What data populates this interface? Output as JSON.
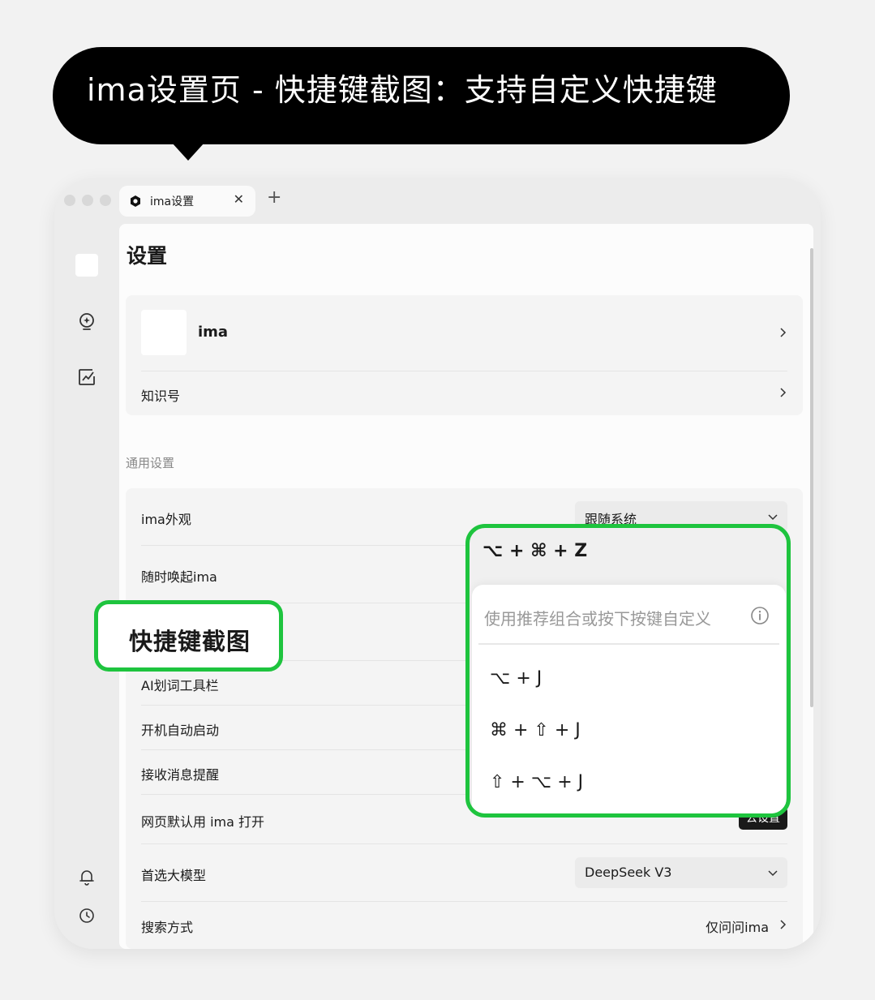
{
  "caption": "ima设置页 - 快捷键截图：支持自定义快捷键",
  "tab": {
    "title": "ima设置",
    "close": "✕",
    "add": "+"
  },
  "sidebar": {
    "icons": [
      "bulb-icon",
      "edit-icon",
      "bell-icon",
      "clock-icon"
    ]
  },
  "page": {
    "title": "设置"
  },
  "account": {
    "name": "ima",
    "knowledge_label": "知识号"
  },
  "section": {
    "general": "通用设置"
  },
  "settings": {
    "appearance_label": "ima外观",
    "appearance_value": "跟随系统",
    "wake_label": "随时唤起ima",
    "ai_toolbar_label": "AI划词工具栏",
    "autostart_label": "开机自动启动",
    "notify_label": "接收消息提醒",
    "webpage_label": "网页默认用 ima 打开",
    "webpage_button": "去设置",
    "model_label": "首选大模型",
    "model_value": "DeepSeek V3",
    "search_label": "搜索方式",
    "search_value": "仅问问ima"
  },
  "callout": {
    "label": "快捷键截图"
  },
  "shortcut_popup": {
    "current": "⌥ + ⌘ + Z",
    "hint": "使用推荐组合或按下按键自定义",
    "options": [
      "⌥ + J",
      "⌘ + ⇧ + J",
      "⇧ + ⌥ + J"
    ]
  },
  "colors": {
    "highlight": "#1ec43e",
    "bubble": "#000000"
  }
}
